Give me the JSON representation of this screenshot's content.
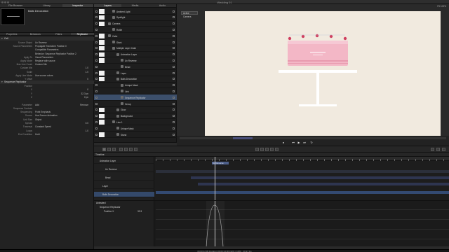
{
  "window": {
    "title": "Wedding 01"
  },
  "left_tabs": [
    "File Browser",
    "Library",
    "Inspector"
  ],
  "left_tabs_active": 2,
  "center_tabs": [
    "Layers",
    "Media",
    "Audio"
  ],
  "object_name": "Balls Decoration",
  "inspector_tabs": [
    "Properties",
    "Behaviors",
    "Filters",
    "Replicator"
  ],
  "inspector_tabs_active": 3,
  "cell_section": "Cell",
  "cell_rows": [
    {
      "label": "Source Object",
      "value": "Ux Reverse",
      "num": ""
    },
    {
      "label": "Source Parameters",
      "value": "Propagate Transform Position 0",
      "num": ""
    },
    {
      "label": "",
      "value": "Compatible Parameters",
      "num": ""
    },
    {
      "label": "",
      "value": "Behavior: Sequence Replicator Position 2",
      "num": ""
    },
    {
      "label": "Apply To",
      "value": "Visual Parameters",
      "num": ""
    },
    {
      "label": "Apply Mode",
      "value": "Replace with source",
      "num": ""
    },
    {
      "label": "Max Line Count",
      "value": "Custom Mix",
      "num": ""
    },
    {
      "label": "Custom Mix",
      "value": "",
      "num": "1.0"
    },
    {
      "label": "Scale",
      "value": "",
      "num": "1.0"
    },
    {
      "label": "Apply Line Mode",
      "value": "Use source colors",
      "num": ""
    },
    {
      "label": "Y offset",
      "value": "",
      "num": "0"
    }
  ],
  "seq_section": "Sequence Replicator",
  "seq_rows": [
    {
      "label": "Position",
      "value": "",
      "num": ""
    },
    {
      "label": "X",
      "value": "",
      "num": "0"
    },
    {
      "label": "Y",
      "value": "",
      "num": "32.3 px"
    },
    {
      "label": "Z",
      "value": "",
      "num": "0 px"
    },
    {
      "label": "",
      "value": "",
      "num": ""
    },
    {
      "label": "Parameter",
      "value": "Add",
      "num": "Remove"
    },
    {
      "label": "Sequence Controls",
      "value": "",
      "num": ""
    },
    {
      "label": "Sequencing",
      "value": "Point Emphasis",
      "num": ""
    },
    {
      "label": "Source",
      "value": "Use Source Animation",
      "num": ""
    },
    {
      "label": "Unit Size",
      "value": "Object",
      "num": ""
    },
    {
      "label": "Spread",
      "value": "",
      "num": "0.0"
    },
    {
      "label": "Traversal",
      "value": "Constant Speed",
      "num": ""
    },
    {
      "label": "Loops",
      "value": "",
      "num": "1.0"
    },
    {
      "label": "End Condition",
      "value": "Hold",
      "num": ""
    }
  ],
  "layers": [
    {
      "name": "Ambient Light",
      "indent": 1,
      "thumb": true
    },
    {
      "name": "Spotlight",
      "indent": 1,
      "thumb": true
    },
    {
      "name": "Camera",
      "indent": 0,
      "thumb": true
    },
    {
      "name": "Rotile",
      "indent": 1,
      "thumb": false
    },
    {
      "name": "Cake",
      "indent": 0,
      "thumb": true
    },
    {
      "name": "Stark",
      "indent": 1,
      "thumb": true
    },
    {
      "name": "Multiple Layer Cake",
      "indent": 1,
      "thumb": true
    },
    {
      "name": "Animation Layer",
      "indent": 2,
      "thumb": true
    },
    {
      "name": "Ux Reverse",
      "indent": 3,
      "thumb": true
    },
    {
      "name": "Bead",
      "indent": 3,
      "thumb": false
    },
    {
      "name": "Layer",
      "indent": 2,
      "thumb": true
    },
    {
      "name": "Balls Decoration",
      "indent": 2,
      "thumb": true
    },
    {
      "name": "Unique Mask",
      "indent": 3,
      "thumb": false
    },
    {
      "name": "Link",
      "indent": 3,
      "thumb": false
    },
    {
      "name": "Sequence Replicator",
      "indent": 3,
      "thumb": false
    },
    {
      "name": "Group",
      "indent": 3,
      "thumb": false
    },
    {
      "name": "Glow",
      "indent": 2,
      "thumb": true
    },
    {
      "name": "Background",
      "indent": 2,
      "thumb": true
    },
    {
      "name": "Line 1",
      "indent": 1,
      "thumb": true
    },
    {
      "name": "Unique Mask",
      "indent": 2,
      "thumb": false
    },
    {
      "name": "Stand",
      "indent": 2,
      "thumb": true
    }
  ],
  "layers_selected": 14,
  "viewer": {
    "camera": "Active Camera",
    "right": "Fit",
    "zoom": "100%"
  },
  "timeline": {
    "title": "Timeline",
    "rows": [
      "Animation Layer",
      "Ux Reverse",
      "Bead",
      "Layer",
      "Balls Decoration"
    ],
    "bar_label": "Ux Reverse"
  },
  "keyframes": {
    "title": "Animated",
    "rows": [
      "Sequence Replicator",
      "Position X"
    ],
    "value": "33.3"
  },
  "status_text": "00:00:12:09  Duration 00:00:14:00  1920 × 1080 · 29.97 fps",
  "colors": {
    "accent": "#3c4f6b",
    "canvas": "#f1eadf",
    "cake": "#f3b7c6"
  }
}
